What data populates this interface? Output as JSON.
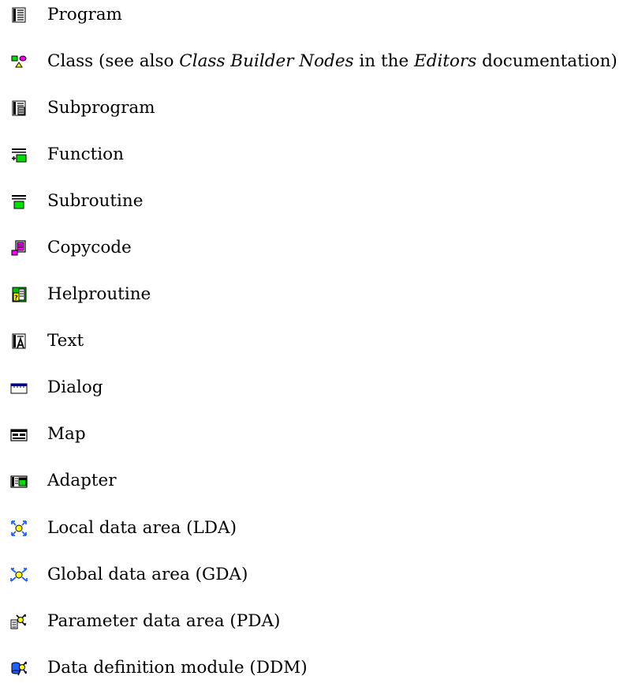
{
  "node_types": [
    {
      "icon": "program-icon",
      "label": "Program"
    },
    {
      "icon": "class-icon",
      "label_parts": [
        "Class (see also ",
        "Class Builder Nodes",
        " in the ",
        "Editors",
        " documentation)"
      ]
    },
    {
      "icon": "subprogram-icon",
      "label": "Subprogram"
    },
    {
      "icon": "function-icon",
      "label": "Function"
    },
    {
      "icon": "subroutine-icon",
      "label": "Subroutine"
    },
    {
      "icon": "copycode-icon",
      "label": "Copycode"
    },
    {
      "icon": "helproutine-icon",
      "label": "Helproutine"
    },
    {
      "icon": "text-icon",
      "label": "Text"
    },
    {
      "icon": "dialog-icon",
      "label": "Dialog"
    },
    {
      "icon": "map-icon",
      "label": "Map"
    },
    {
      "icon": "adapter-icon",
      "label": "Adapter"
    },
    {
      "icon": "local-data-area-icon",
      "label": "Local data area (LDA)"
    },
    {
      "icon": "global-data-area-icon",
      "label": "Global data area (GDA)"
    },
    {
      "icon": "parameter-data-area-icon",
      "label": "Parameter data area (PDA)"
    },
    {
      "icon": "data-definition-module-icon",
      "label": "Data definition module (DDM)"
    }
  ],
  "colors": {
    "green": "#00e000",
    "magenta": "#ff00ff",
    "yellow": "#ffff00",
    "blue": "#2060ff",
    "dark_blue": "#000080",
    "navy": "#000040"
  }
}
